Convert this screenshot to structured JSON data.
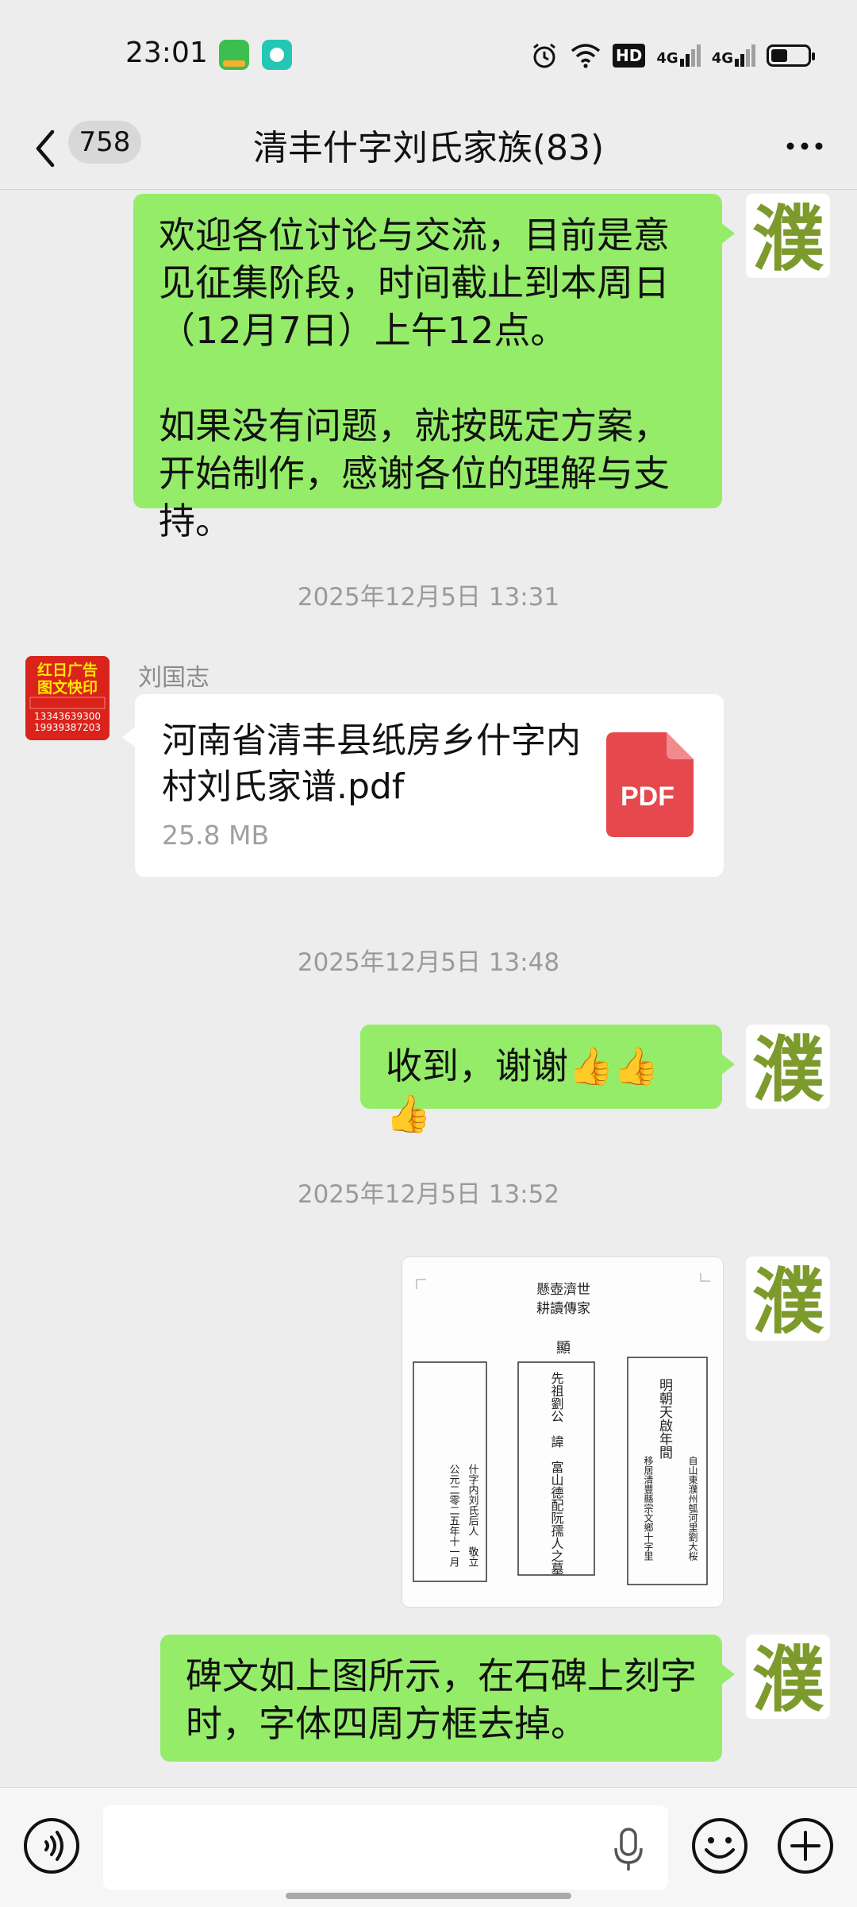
{
  "status_bar": {
    "time": "23:01",
    "hd_label": "HD",
    "network_1": "4G",
    "network_2": "4G"
  },
  "nav": {
    "unread_count": "758",
    "title": "清丰什字刘氏家族(83)"
  },
  "messages": {
    "m1": {
      "direction": "out",
      "paragraph1": "欢迎各位讨论与交流，目前是意见征集阶段，时间截止到本周日（12月7日）上午12点。",
      "paragraph2": "如果没有问题，就按既定方案，开始制作，感谢各位的理解与支持。",
      "avatar_char": "濮"
    },
    "ts1": "2025年12月5日 13:31",
    "m2": {
      "direction": "in",
      "sender": "刘国志",
      "file_name": "河南省清丰县纸房乡什字内村刘氏家谱.pdf",
      "file_size": "25.8 MB",
      "file_type": "PDF",
      "avatar": {
        "line1": "红日广告",
        "line2": "图文快印",
        "phone1": "13343639300",
        "phone2": "19939387203"
      }
    },
    "ts2": "2025年12月5日 13:48",
    "m3": {
      "direction": "out",
      "text": "收到，谢谢👍👍👍",
      "avatar_char": "濮"
    },
    "ts3": "2025年12月5日 13:52",
    "m4": {
      "direction": "out",
      "type": "image",
      "avatar_char": "濮",
      "tablet": {
        "top_line1": "懸壺濟世",
        "top_line2": "耕讀傳家",
        "header": "顯",
        "left_col": "什字内刘氏后人　敬立",
        "left_col2": "公元二零二五年十一月",
        "center_col": "先祖劉公　諱　富山德配阮孺人之墓",
        "right_col1": "明朝天啟年間",
        "right_col2": "自山東濮州瓠河里劉大桜",
        "right_col3": "移居清豐縣宗文鄉十字里"
      }
    },
    "m5": {
      "direction": "out",
      "text": "碑文如上图所示，在石碑上刻字时，字体四周方框去掉。",
      "avatar_char": "濮"
    }
  },
  "colors": {
    "bubble_out": "#95ec69",
    "background": "#ededed",
    "pdf_red": "#e5484d"
  },
  "icons": [
    "back-arrow-icon",
    "more-icon",
    "pdf-icon",
    "voice-icon",
    "mic-icon",
    "emoji-icon",
    "plus-icon"
  ]
}
